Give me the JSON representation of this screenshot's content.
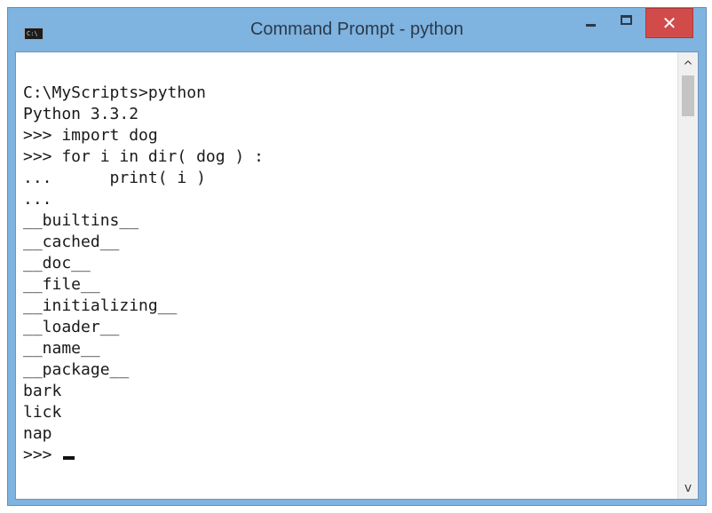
{
  "window": {
    "title": "Command Prompt - python",
    "icon_label": "C:\\",
    "close_glyph": "✕"
  },
  "console": {
    "lines": [
      "C:\\MyScripts>python",
      "Python 3.3.2",
      ">>> import dog",
      ">>> for i in dir( dog ) :",
      "...      print( i )",
      "...",
      "__builtins__",
      "__cached__",
      "__doc__",
      "__file__",
      "__initializing__",
      "__loader__",
      "__name__",
      "__package__",
      "bark",
      "lick",
      "nap"
    ],
    "prompt": ">>> "
  },
  "scrollbar": {
    "up_arrow": "^",
    "down_arrow": "v"
  },
  "icons": [
    "cmd-app-icon",
    "minimize-icon",
    "maximize-icon",
    "close-icon",
    "scroll-up-icon",
    "scroll-down-icon"
  ]
}
